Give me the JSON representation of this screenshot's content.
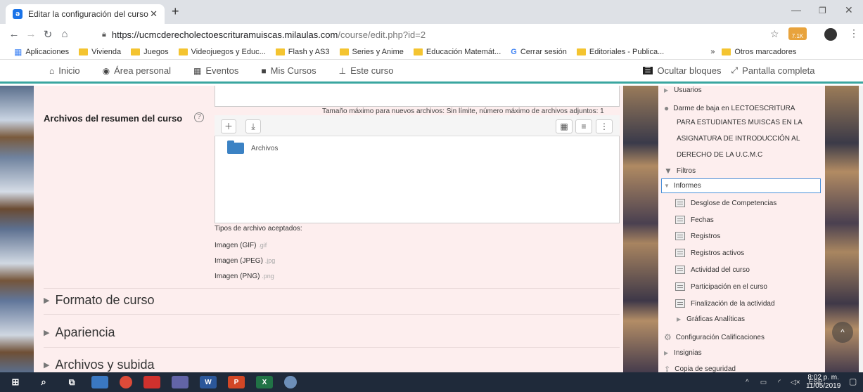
{
  "browser": {
    "tab_title": "Editar la configuración del curso",
    "tab_close": "✕",
    "new_tab": "+",
    "url_host": "https://ucmcderecholectoescrituramuiscas.milaulas.com",
    "url_path": "/course/edit.php?id=2",
    "extension_badge": "7.1K",
    "bookmarks": [
      "Aplicaciones",
      "Vivienda",
      "Juegos",
      "Videojuegos y Educ...",
      "Flash y AS3",
      "Series y Anime",
      "Educación Matemát...",
      "Cerrar sesión",
      "Editoriales - Publica..."
    ],
    "bookmarks_more": "»",
    "other_bookmarks": "Otros marcadores"
  },
  "navbar": {
    "items": [
      "Inicio",
      "Área personal",
      "Eventos",
      "Mis Cursos",
      "Este curso"
    ],
    "hide_blocks": "Ocultar bloques",
    "fullscreen": "Pantalla completa"
  },
  "form": {
    "field_label": "Archivos del resumen del curso",
    "help": "?",
    "max_size": "Tamaño máximo para nuevos archivos: Sin límite, número máximo de archivos adjuntos: 1",
    "folder_name": "Archivos",
    "accepted_types_label": "Tipos de archivo aceptados:",
    "accepted_types": [
      {
        "name": "Imagen (GIF)",
        "ext": ".gif"
      },
      {
        "name": "Imagen (JPEG)",
        "ext": ".jpg"
      },
      {
        "name": "Imagen (PNG)",
        "ext": ".png"
      }
    ],
    "sections": [
      "Formato de curso",
      "Apariencia",
      "Archivos y subida"
    ]
  },
  "admin_block": {
    "usuarios": "Usuarios",
    "unenrol_lines": [
      "Darme de baja en LECTOESCRITURA",
      "PARA ESTUDIANTES MUISCAS EN LA",
      "ASIGNATURA DE INTRODUCCIÓN AL",
      "DERECHO DE LA U.C.M.C"
    ],
    "filtros": "Filtros",
    "informes": "Informes",
    "reports": [
      "Desglose de Competencias",
      "Fechas",
      "Registros",
      "Registros activos",
      "Actividad del curso",
      "Participación en el curso",
      "Finalización de la actividad"
    ],
    "graficas": "Gráficas Analíticas",
    "calificaciones": "Configuración Calificaciones",
    "insignias": "Insignias",
    "copia": "Copia de seguridad"
  },
  "taskbar": {
    "lang": "ESP",
    "time": "8:02 p. m.",
    "date": "11/05/2019"
  },
  "colors": {
    "accent": "#3aa6a0",
    "page_bg": "#fdeeee",
    "taskbar": "#1f2a3a"
  }
}
